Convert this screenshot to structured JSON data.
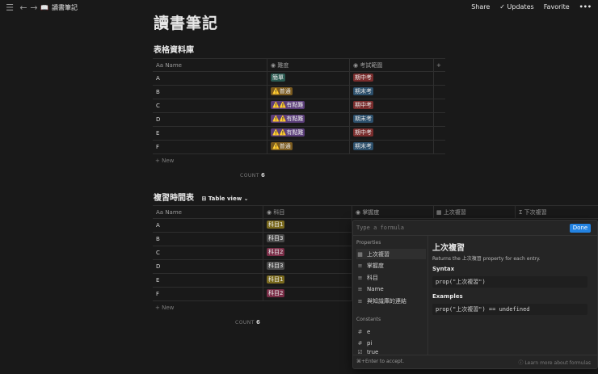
{
  "topbar": {
    "breadcrumb_title": "讀書筆記",
    "share_label": "Share",
    "updates_label": "Updates",
    "favorite_label": "Favorite",
    "more_label": "•••"
  },
  "page": {
    "title": "讀書筆記"
  },
  "db1": {
    "title": "表格資料庫",
    "columns": [
      "Name",
      "難度",
      "考試範圍"
    ],
    "add_column": "+",
    "rows": [
      {
        "name": "A",
        "difficulty": "簡單",
        "scope": "期中考"
      },
      {
        "name": "B",
        "difficulty": "⚠️普通",
        "scope": "期末考"
      },
      {
        "name": "C",
        "difficulty": "⚠️⚠️有點難",
        "scope": "期中考"
      },
      {
        "name": "D",
        "difficulty": "⚠️⚠️有點難",
        "scope": "期末考"
      },
      {
        "name": "E",
        "difficulty": "⚠️⚠️有點難",
        "scope": "期中考"
      },
      {
        "name": "F",
        "difficulty": "⚠️普通",
        "scope": "期末考"
      }
    ],
    "new_label": "+ New",
    "count_label": "COUNT",
    "count_value": "6"
  },
  "db2": {
    "title": "複習時間表",
    "view_label": "Table view",
    "columns": [
      "Name",
      "科目",
      "掌握度",
      "上次複習",
      "下次複習"
    ],
    "rows": [
      {
        "name": "A",
        "subject": "科目1"
      },
      {
        "name": "B",
        "subject": "科目3"
      },
      {
        "name": "C",
        "subject": "科目2"
      },
      {
        "name": "D",
        "subject": "科目3"
      },
      {
        "name": "E",
        "subject": "科目1"
      },
      {
        "name": "F",
        "subject": "科目2"
      }
    ],
    "new_label": "+ New",
    "count_label": "COUNT",
    "count_value": "6"
  },
  "formula": {
    "placeholder": "Type a formula",
    "done_label": "Done",
    "properties_label": "Properties",
    "properties": [
      {
        "label": "上次複習",
        "icon": "calendar-icon"
      },
      {
        "label": "掌握度",
        "icon": "text-icon"
      },
      {
        "label": "科目",
        "icon": "text-icon"
      },
      {
        "label": "Name",
        "icon": "text-icon"
      },
      {
        "label": "與知識庫的連結",
        "icon": "text-icon"
      }
    ],
    "constants_label": "Constants",
    "constants": [
      {
        "label": "e",
        "icon": "hash-icon"
      },
      {
        "label": "pi",
        "icon": "hash-icon"
      },
      {
        "label": "true",
        "icon": "checkbox-icon"
      }
    ],
    "detail_title": "上次複習",
    "detail_desc": "Returns the 上次複習 property for each entry.",
    "syntax_label": "Syntax",
    "syntax_code": "prop(\"上次複習\")",
    "examples_label": "Examples",
    "example_code": "prop(\"上次複習\") == undefined",
    "footer_hint": "⌘+Enter to accept.",
    "learn_more": "Learn more about formulas"
  },
  "colors": {
    "tag_easy": "#2b5b52",
    "tag_normal": "#7a5a1e",
    "tag_hard": "#5b3e7a",
    "tag_midterm": "#7a2d2d",
    "tag_final": "#2c4f6b",
    "subject1": "#7a6a1e",
    "subject2": "#7a2d47",
    "subject3": "#4a4a4a",
    "accent": "#2383e2"
  }
}
